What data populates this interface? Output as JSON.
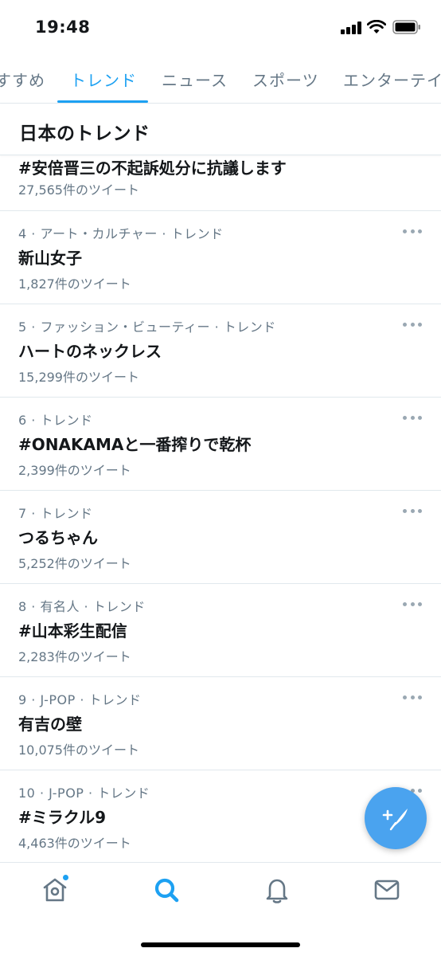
{
  "status_bar": {
    "time": "19:48"
  },
  "tabs": [
    {
      "label": "すすめ",
      "active": false
    },
    {
      "label": "トレンド",
      "active": true
    },
    {
      "label": "ニュース",
      "active": false
    },
    {
      "label": "スポーツ",
      "active": false
    },
    {
      "label": "エンターテイメ",
      "active": false
    }
  ],
  "section": {
    "title": "日本のトレンド"
  },
  "trends": [
    {
      "meta": "",
      "name": "#安倍晋三の不起訴処分に抗議します",
      "count": "27,565件のツイート"
    },
    {
      "meta": "4 · アート・カルチャー · トレンド",
      "name": "新山女子",
      "count": "1,827件のツイート"
    },
    {
      "meta": "5 · ファッション・ビューティー · トレンド",
      "name": "ハートのネックレス",
      "count": "15,299件のツイート"
    },
    {
      "meta": "6 · トレンド",
      "name": "#ONAKAMAと一番搾りで乾杯",
      "count": "2,399件のツイート"
    },
    {
      "meta": "7 · トレンド",
      "name": "つるちゃん",
      "count": "5,252件のツイート"
    },
    {
      "meta": "8 · 有名人 · トレンド",
      "name": "#山本彩生配信",
      "count": "2,283件のツイート"
    },
    {
      "meta": "9 · J-POP · トレンド",
      "name": "有吉の壁",
      "count": "10,075件のツイート"
    },
    {
      "meta": "10 · J-POP · トレンド",
      "name": "#ミラクル9",
      "count": "4,463件のツイート"
    }
  ],
  "icons": {
    "fab": "compose-tweet-icon",
    "nav": [
      "home-icon",
      "search-icon",
      "notifications-icon",
      "messages-icon"
    ]
  },
  "colors": {
    "accent": "#1da1f2",
    "secondary_text": "#657786",
    "fab": "#4aa3ef"
  }
}
